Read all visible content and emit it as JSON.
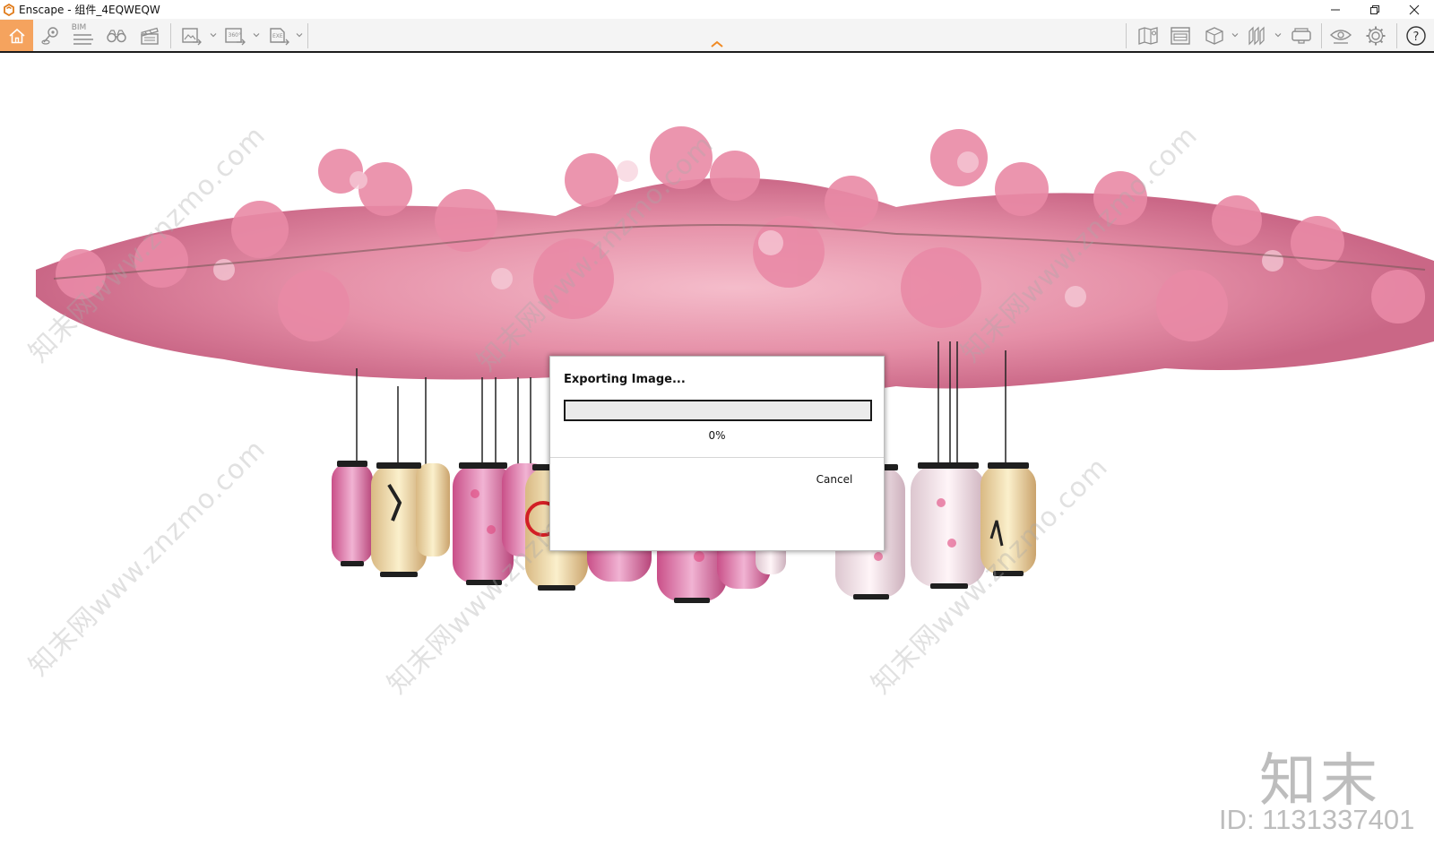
{
  "window": {
    "title": "Enscape - 组件_4EQWEQW"
  },
  "toolbar": {
    "left_tools": [
      "home-icon",
      "location-pin-icon",
      "bim-icon",
      "binoculars-icon",
      "video-editor-icon",
      "screenshot-export-icon",
      "panorama-360-icon",
      "exe-export-icon"
    ],
    "bim_label": "BIM",
    "pano_label": "360°",
    "exe_label": "EXE",
    "right_tools": [
      "map-icon",
      "asset-library-icon",
      "cube-view-icon",
      "section-icon",
      "vr-headset-icon",
      "visual-settings-icon",
      "settings-gear-icon",
      "help-icon"
    ],
    "help_glyph": "?",
    "accent_color": "#f5a35e"
  },
  "viewport": {
    "watermark_text": "知末网www.znzmo.com",
    "brand_logo": "知末",
    "brand_id": "ID: 1131337401"
  },
  "dialog": {
    "title": "Exporting Image...",
    "progress": 0,
    "progress_text": "0%",
    "cancel_label": "Cancel"
  }
}
